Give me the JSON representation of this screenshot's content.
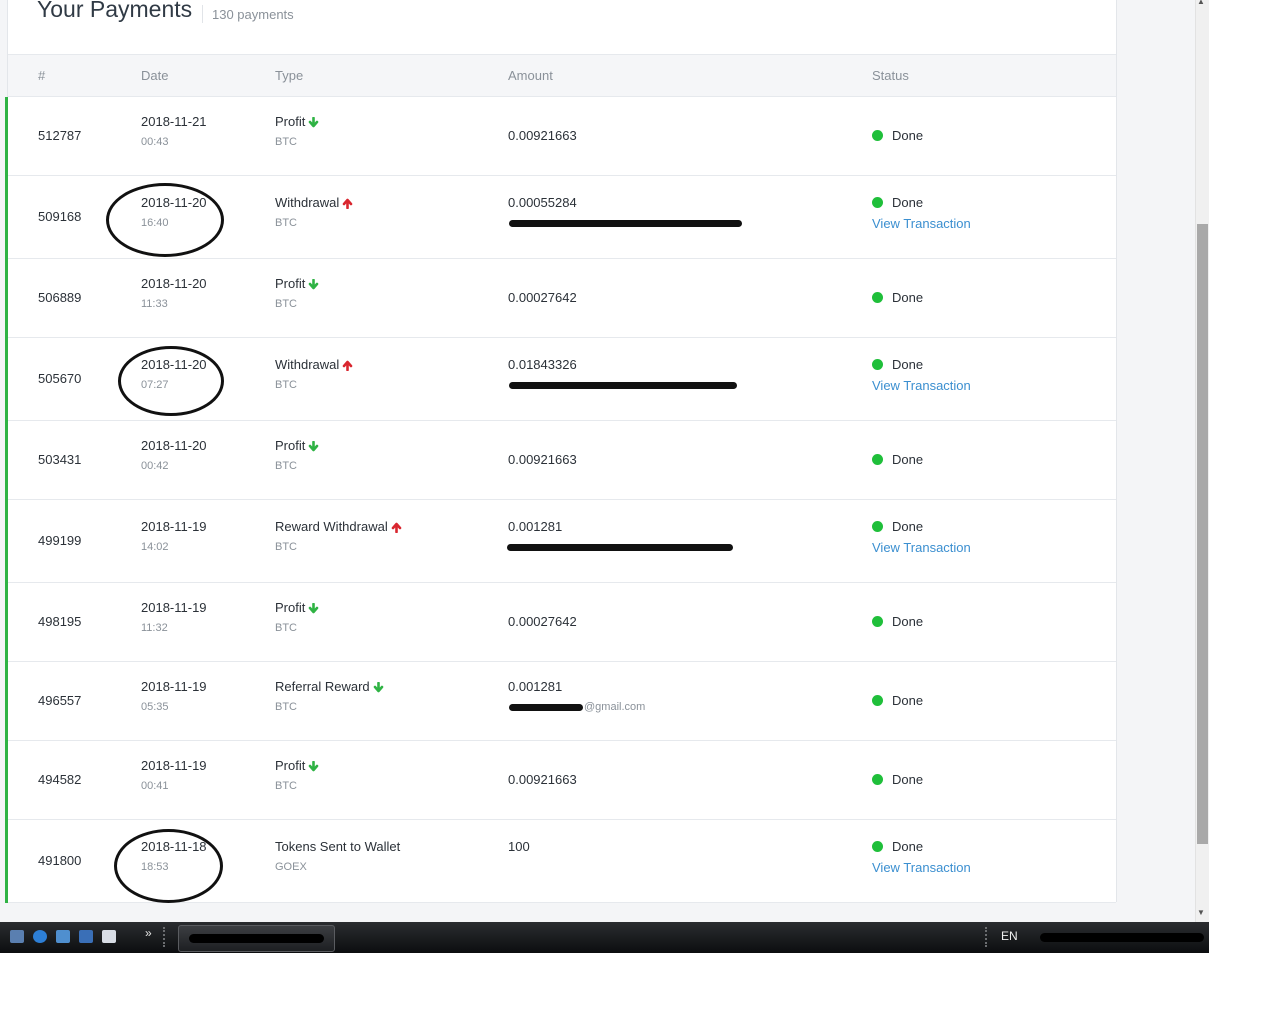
{
  "page": {
    "title": "Your Payments",
    "count": "130 payments"
  },
  "table": {
    "columns": [
      "#",
      "Date",
      "Type",
      "Amount",
      "Status"
    ],
    "rows": [
      {
        "id": "512787",
        "date": "2018-11-21",
        "time": "00:43",
        "type": "Profit",
        "direction": "in",
        "currency": "BTC",
        "amount": "0.00921663",
        "amount_note": "",
        "status": "Done",
        "link": ""
      },
      {
        "id": "509168",
        "date": "2018-11-20",
        "time": "16:40",
        "type": "Withdrawal",
        "direction": "out",
        "currency": "BTC",
        "amount": "0.00055284",
        "amount_note": "",
        "status": "Done",
        "link": "View Transaction"
      },
      {
        "id": "506889",
        "date": "2018-11-20",
        "time": "11:33",
        "type": "Profit",
        "direction": "in",
        "currency": "BTC",
        "amount": "0.00027642",
        "amount_note": "",
        "status": "Done",
        "link": ""
      },
      {
        "id": "505670",
        "date": "2018-11-20",
        "time": "07:27",
        "type": "Withdrawal",
        "direction": "out",
        "currency": "BTC",
        "amount": "0.01843326",
        "amount_note": "",
        "status": "Done",
        "link": "View Transaction"
      },
      {
        "id": "503431",
        "date": "2018-11-20",
        "time": "00:42",
        "type": "Profit",
        "direction": "in",
        "currency": "BTC",
        "amount": "0.00921663",
        "amount_note": "",
        "status": "Done",
        "link": ""
      },
      {
        "id": "499199",
        "date": "2018-11-19",
        "time": "14:02",
        "type": "Reward Withdrawal",
        "direction": "out",
        "currency": "BTC",
        "amount": "0.001281",
        "amount_note": "",
        "status": "Done",
        "link": "View Transaction"
      },
      {
        "id": "498195",
        "date": "2018-11-19",
        "time": "11:32",
        "type": "Profit",
        "direction": "in",
        "currency": "BTC",
        "amount": "0.00027642",
        "amount_note": "",
        "status": "Done",
        "link": ""
      },
      {
        "id": "496557",
        "date": "2018-11-19",
        "time": "05:35",
        "type": "Referral Reward",
        "direction": "in",
        "currency": "BTC",
        "amount": "0.001281",
        "amount_note": "@gmail.com",
        "status": "Done",
        "link": ""
      },
      {
        "id": "494582",
        "date": "2018-11-19",
        "time": "00:41",
        "type": "Profit",
        "direction": "in",
        "currency": "BTC",
        "amount": "0.00921663",
        "amount_note": "",
        "status": "Done",
        "link": ""
      },
      {
        "id": "491800",
        "date": "2018-11-18",
        "time": "18:53",
        "type": "Tokens Sent to Wallet",
        "direction": "",
        "currency": "GOEX",
        "amount": "100",
        "amount_note": "",
        "status": "Done",
        "link": "View Transaction"
      }
    ]
  },
  "taskbar": {
    "language": "EN",
    "more_glyph": "»"
  },
  "colors": {
    "accent_green": "#2fb344",
    "status_done": "#1fbf3a",
    "arrow_in": "#2fb344",
    "arrow_out": "#d9262f",
    "link": "#3b8fd0"
  }
}
